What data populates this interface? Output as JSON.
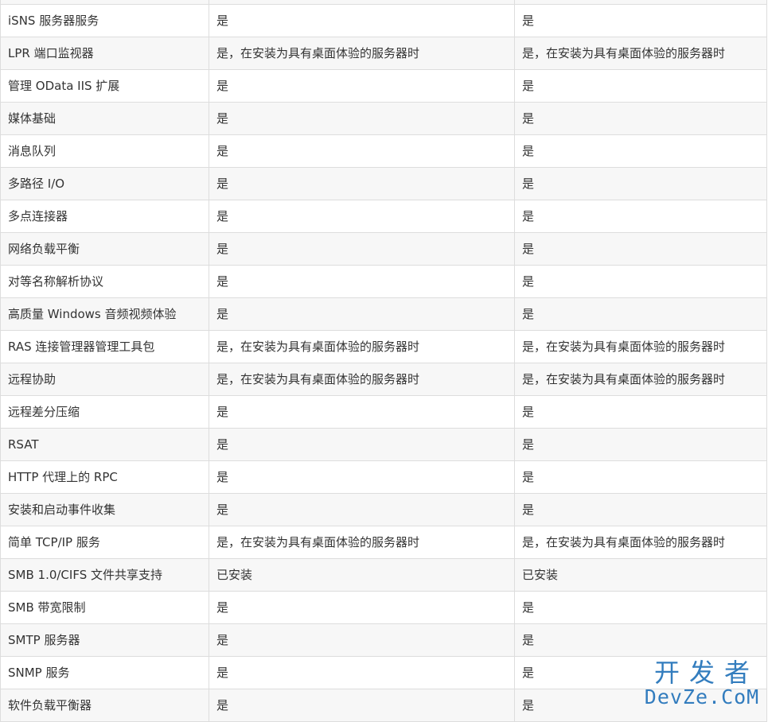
{
  "table": {
    "rows": [
      [
        "",
        "",
        ""
      ],
      [
        "iSNS 服务器服务",
        "是",
        "是"
      ],
      [
        "LPR 端口监视器",
        "是，在安装为具有桌面体验的服务器时",
        "是，在安装为具有桌面体验的服务器时"
      ],
      [
        "管理 OData IIS 扩展",
        "是",
        "是"
      ],
      [
        "媒体基础",
        "是",
        "是"
      ],
      [
        "消息队列",
        "是",
        "是"
      ],
      [
        "多路径 I/O",
        "是",
        "是"
      ],
      [
        "多点连接器",
        "是",
        "是"
      ],
      [
        "网络负载平衡",
        "是",
        "是"
      ],
      [
        "对等名称解析协议",
        "是",
        "是"
      ],
      [
        "高质量 Windows 音频视频体验",
        "是",
        "是"
      ],
      [
        "RAS 连接管理器管理工具包",
        "是，在安装为具有桌面体验的服务器时",
        "是，在安装为具有桌面体验的服务器时"
      ],
      [
        "远程协助",
        "是，在安装为具有桌面体验的服务器时",
        "是，在安装为具有桌面体验的服务器时"
      ],
      [
        "远程差分压缩",
        "是",
        "是"
      ],
      [
        "RSAT",
        "是",
        "是"
      ],
      [
        "HTTP 代理上的 RPC",
        "是",
        "是"
      ],
      [
        "安装和启动事件收集",
        "是",
        "是"
      ],
      [
        "简单 TCP/IP 服务",
        "是，在安装为具有桌面体验的服务器时",
        "是，在安装为具有桌面体验的服务器时"
      ],
      [
        "SMB 1.0/CIFS 文件共享支持",
        "已安装",
        "已安装"
      ],
      [
        "SMB 带宽限制",
        "是",
        "是"
      ],
      [
        "SMTP 服务器",
        "是",
        "是"
      ],
      [
        "SNMP 服务",
        "是",
        "是"
      ],
      [
        "软件负载平衡器",
        "是",
        "是"
      ]
    ]
  },
  "watermark": {
    "chinese": "开发者",
    "english": "DevZe.CoM"
  }
}
